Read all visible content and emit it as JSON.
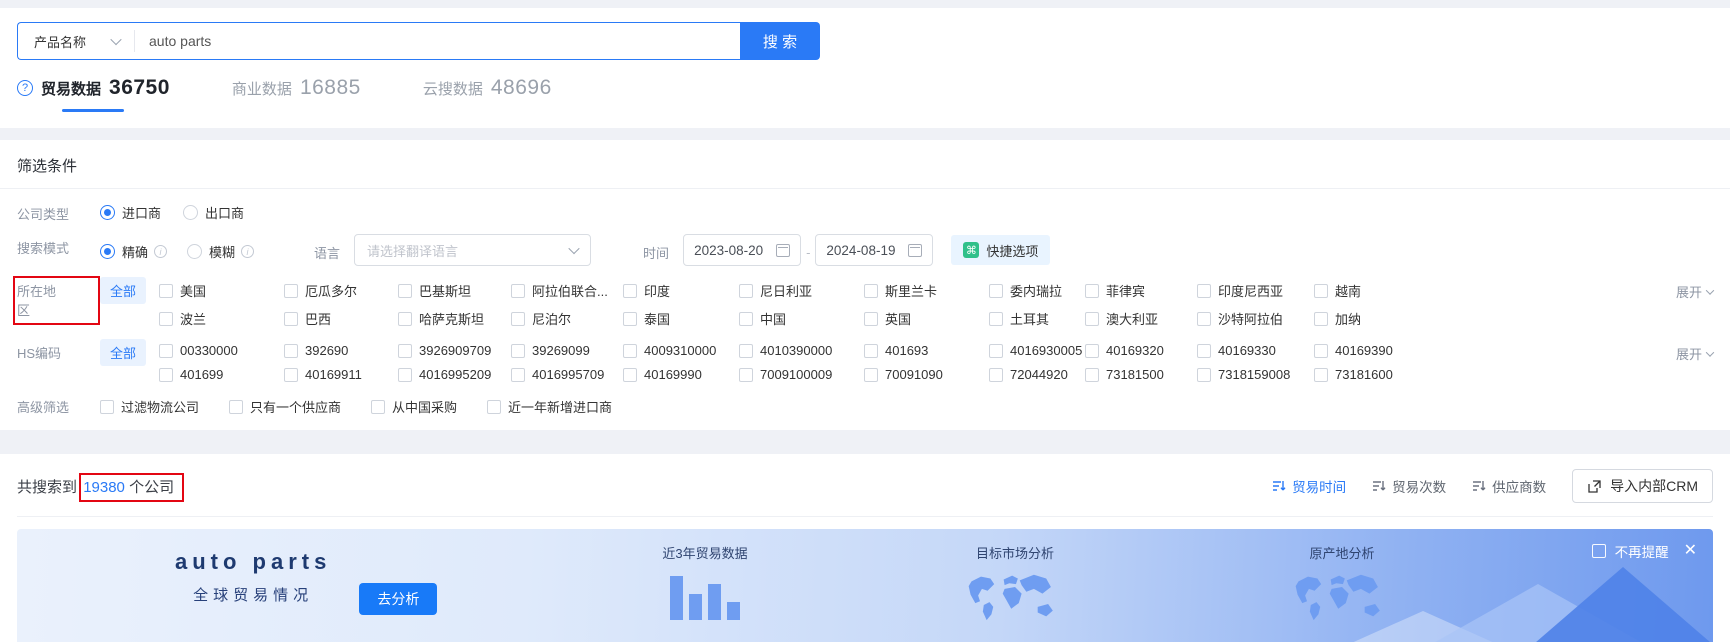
{
  "search": {
    "category": "产品名称",
    "query": "auto parts",
    "button_label": "搜 索"
  },
  "tabs": [
    {
      "label": "贸易数据",
      "count": "36750"
    },
    {
      "label": "商业数据",
      "count": "16885"
    },
    {
      "label": "云搜数据",
      "count": "48696"
    }
  ],
  "filters": {
    "title": "筛选条件",
    "company_type": {
      "label": "公司类型",
      "importer": "进口商",
      "exporter": "出口商"
    },
    "search_mode": {
      "label": "搜索模式",
      "exact": "精确",
      "fuzzy": "模糊"
    },
    "language": {
      "label": "语言",
      "placeholder": "请选择翻译语言"
    },
    "time": {
      "label": "时间",
      "start": "2023-08-20",
      "separator": "-",
      "end": "2024-08-19"
    },
    "quick_option": "快捷选项",
    "region": {
      "label": "所在地区",
      "all": "全部",
      "expand": "展开",
      "rows": [
        [
          "美国",
          "厄瓜多尔",
          "巴基斯坦",
          "阿拉伯联合...",
          "印度",
          "尼日利亚",
          "斯里兰卡",
          "委内瑞拉",
          "菲律宾",
          "印度尼西亚",
          "越南"
        ],
        [
          "波兰",
          "巴西",
          "哈萨克斯坦",
          "尼泊尔",
          "泰国",
          "中国",
          "英国",
          "土耳其",
          "澳大利亚",
          "沙特阿拉伯",
          "加纳"
        ]
      ]
    },
    "hs": {
      "label": "HS编码",
      "all": "全部",
      "expand": "展开",
      "rows": [
        [
          "00330000",
          "392690",
          "3926909709",
          "39269099",
          "4009310000",
          "4010390000",
          "401693",
          "4016930005",
          "40169320",
          "40169330",
          "40169390"
        ],
        [
          "401699",
          "40169911",
          "4016995209",
          "4016995709",
          "40169990",
          "7009100009",
          "70091090",
          "72044920",
          "73181500",
          "7318159008",
          "73181600"
        ]
      ]
    },
    "advanced": {
      "label": "高级筛选",
      "options": [
        "过滤物流公司",
        "只有一个供应商",
        "从中国采购",
        "近一年新增进口商"
      ]
    }
  },
  "results": {
    "prefix": "共搜索到",
    "count": "19380",
    "suffix": "个公司",
    "sorts": [
      "贸易时间",
      "贸易次数",
      "供应商数"
    ],
    "crm_button": "导入内部CRM"
  },
  "banner": {
    "title": "auto parts",
    "subtitle": "全球贸易情况",
    "analyze_button": "去分析",
    "features": [
      "近3年贸易数据",
      "目标市场分析",
      "原产地分析"
    ],
    "dismiss": "不再提醒"
  },
  "colors": {
    "primary": "#2a7af6",
    "chip_bg": "#e9f2fe",
    "annotation_red": "#e30613",
    "banner_icon_blue": "#6f9df1",
    "quick_icon_green": "#30c08a"
  }
}
